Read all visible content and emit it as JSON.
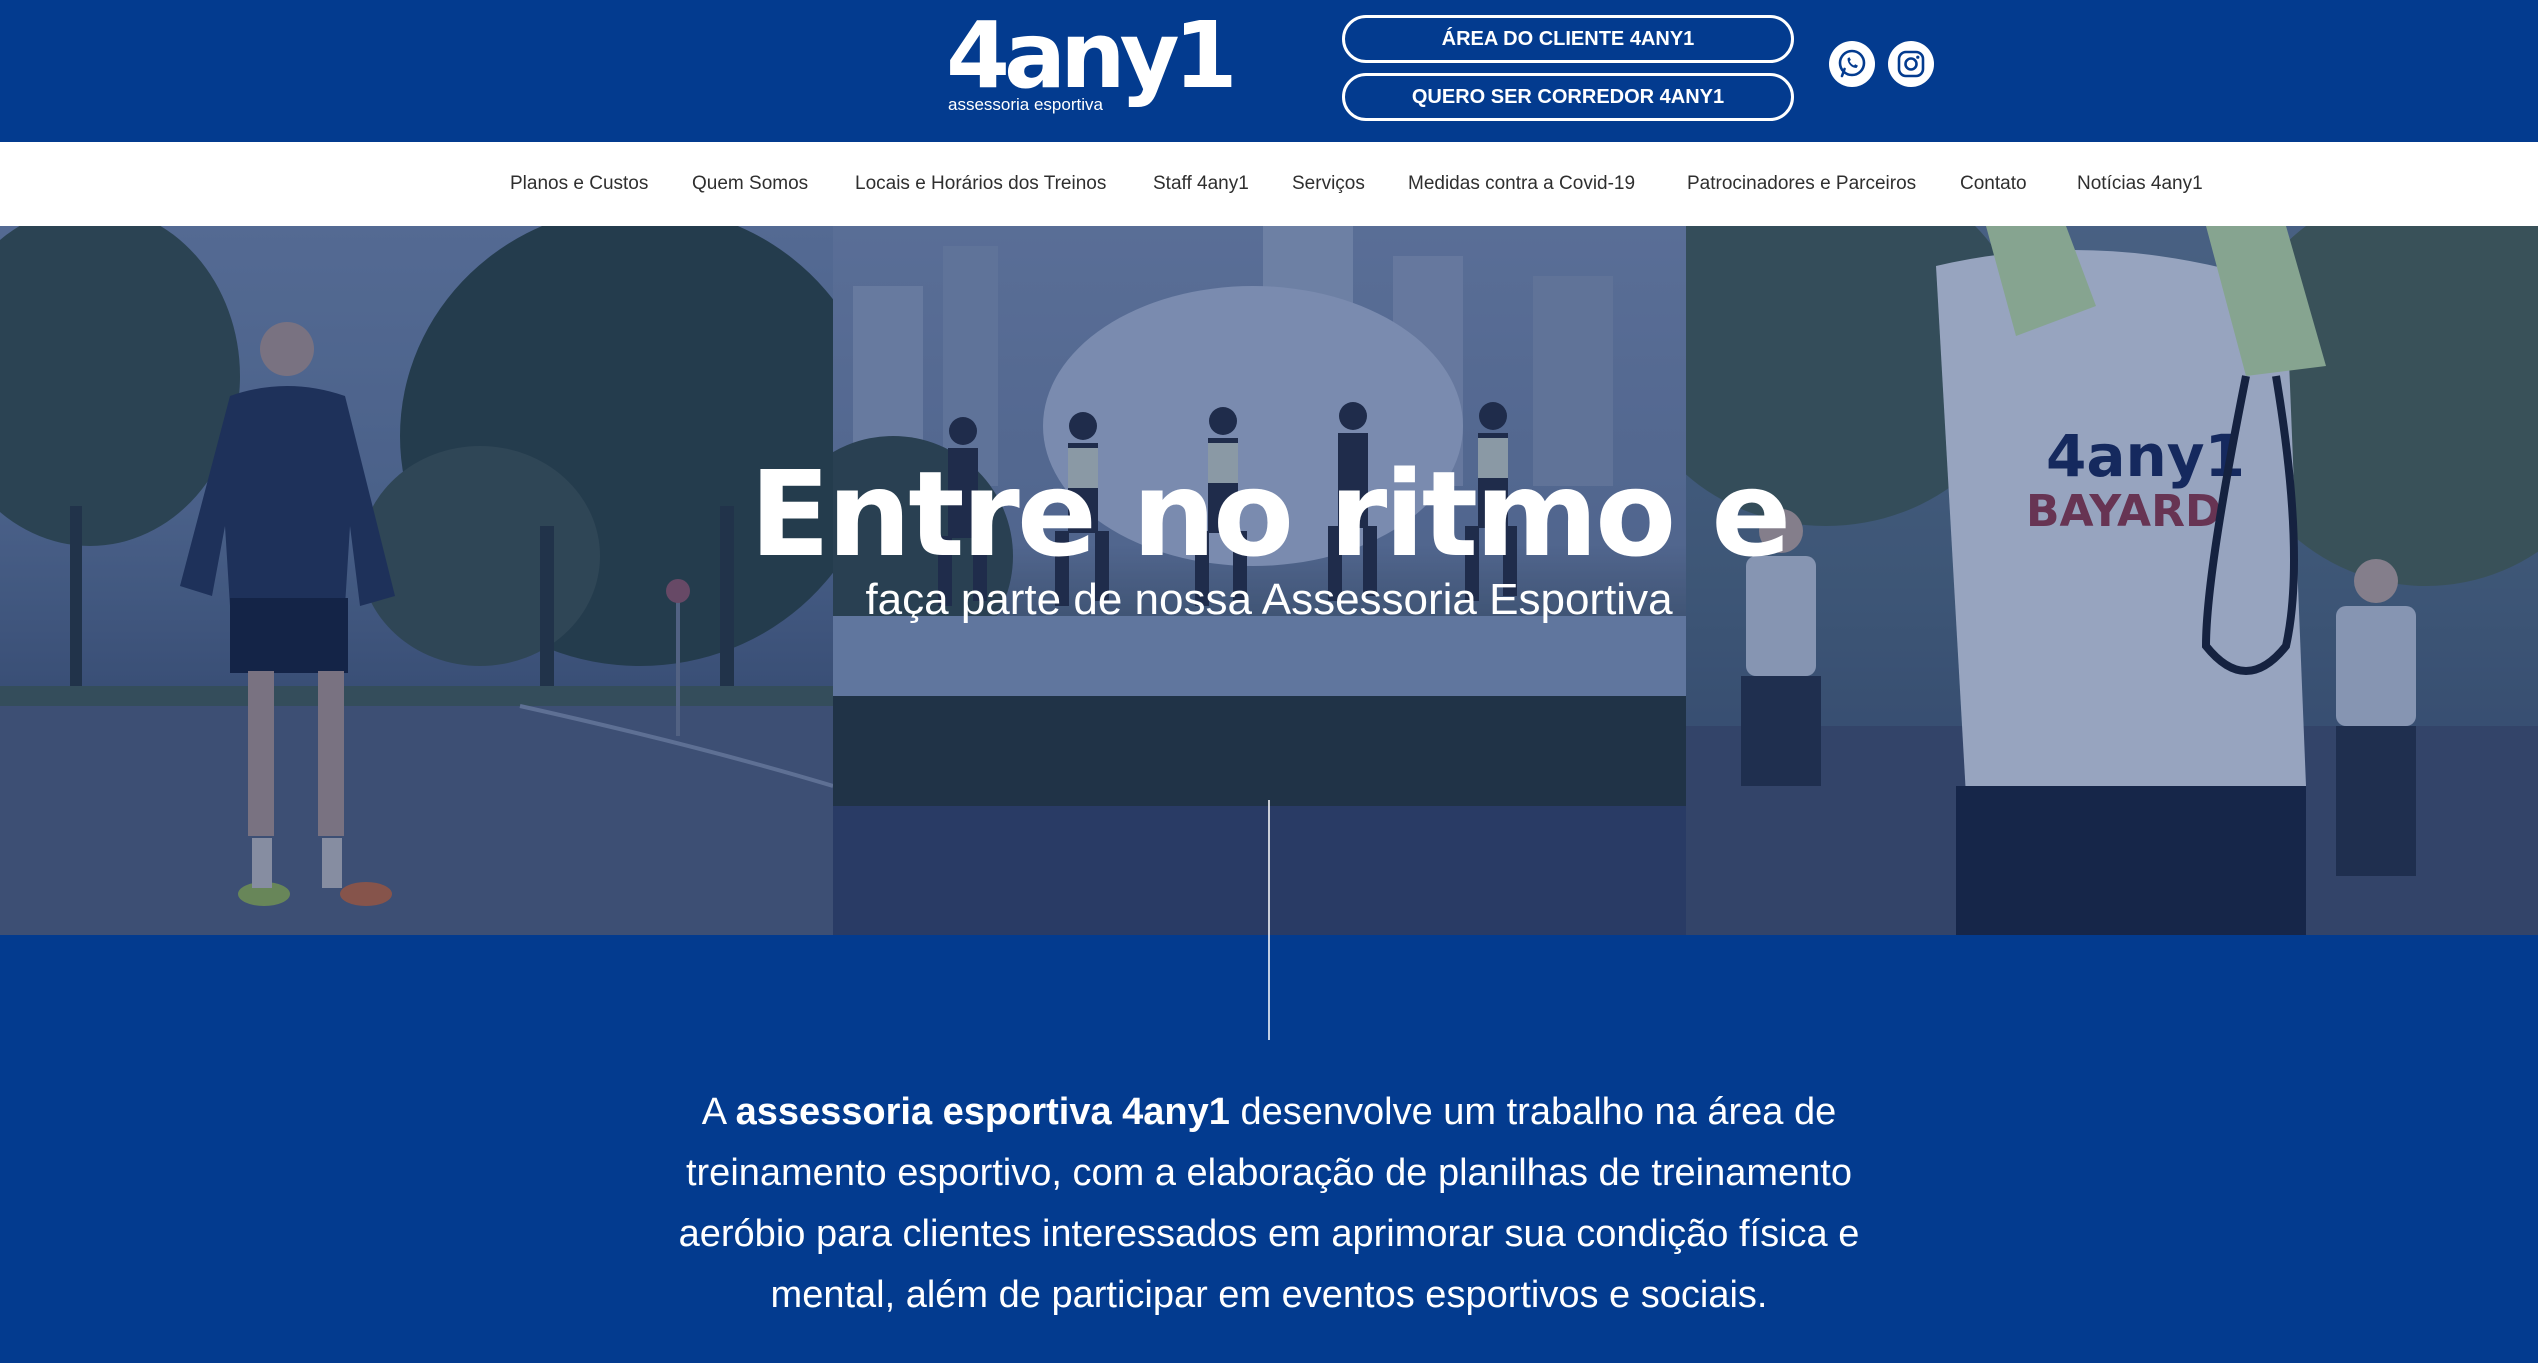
{
  "brand": {
    "logo_text": "4any1",
    "logo_subtitle": "assessoria esportiva",
    "primary_color": "#033b8f",
    "background_color": "#ffffff"
  },
  "header": {
    "cta_client_area": "ÁREA DO CLIENTE 4ANY1",
    "cta_become_runner": "QUERO SER CORREDOR 4ANY1",
    "social_icons": [
      "whatsapp-icon",
      "instagram-icon"
    ]
  },
  "nav": {
    "items": [
      "Planos e Custos",
      "Quem Somos",
      "Locais e Horários dos Treinos",
      "Staff 4any1",
      "Serviços",
      "Medidas contra a Covid-19",
      "Patrocinadores e Parceiros",
      "Contato",
      "Notícias 4any1"
    ]
  },
  "hero": {
    "title": "Entre no ritmo e",
    "subtitle": "faça parte de nossa Assessoria Esportiva"
  },
  "about": {
    "prefix": "A ",
    "highlight": "assessoria esportiva 4any1",
    "body": " desenvolve um trabalho na área de treinamento esportivo, com a elaboração de planilhas de treinamento aeróbio para clientes interessados em aprimorar sua condição física e mental, além de participar em eventos esportivos e sociais."
  }
}
